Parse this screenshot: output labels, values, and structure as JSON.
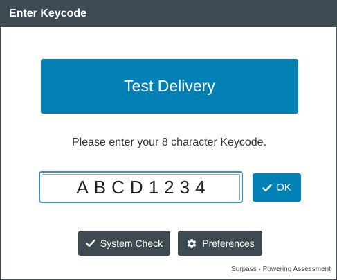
{
  "dialog": {
    "title": "Enter Keycode"
  },
  "banner": {
    "label": "Test Delivery"
  },
  "prompt": {
    "text": "Please enter your 8 character Keycode."
  },
  "keycode": {
    "value": "ABCD1234"
  },
  "actions": {
    "ok_label": "OK",
    "system_check_label": "System Check",
    "preferences_label": "Preferences"
  },
  "footer": {
    "link_text": "Surpass - Powering Assessment"
  },
  "icons": {
    "ok": "check-icon",
    "system_check": "check-icon",
    "preferences": "gear-icon"
  },
  "colors": {
    "title_bar": "#3d4a52",
    "primary": "#0180b5",
    "dark_button": "#3d4a52",
    "input_focus_border": "#3a8fc6"
  }
}
